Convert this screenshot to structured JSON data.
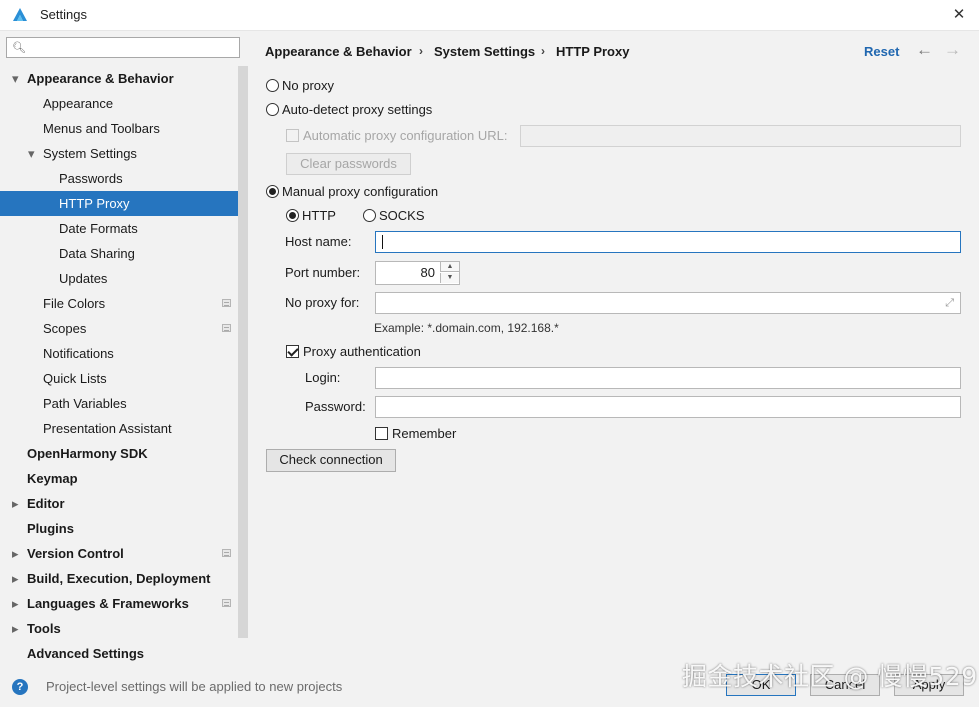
{
  "window": {
    "title": "Settings",
    "app_logo_icon": "harmony-logo-icon",
    "close_icon": "close-icon"
  },
  "search": {
    "icon": "search-icon",
    "value": "",
    "placeholder": ""
  },
  "sidebar": {
    "items": [
      {
        "label": "Appearance & Behavior",
        "level": 0,
        "expanded": true,
        "bold": true
      },
      {
        "label": "Appearance",
        "level": 1
      },
      {
        "label": "Menus and Toolbars",
        "level": 1
      },
      {
        "label": "System Settings",
        "level": 1,
        "expanded": true
      },
      {
        "label": "Passwords",
        "level": 2
      },
      {
        "label": "HTTP Proxy",
        "level": 2,
        "selected": true
      },
      {
        "label": "Date Formats",
        "level": 2
      },
      {
        "label": "Data Sharing",
        "level": 2
      },
      {
        "label": "Updates",
        "level": 2
      },
      {
        "label": "File Colors",
        "level": 1,
        "project_marker": true
      },
      {
        "label": "Scopes",
        "level": 1,
        "project_marker": true
      },
      {
        "label": "Notifications",
        "level": 1
      },
      {
        "label": "Quick Lists",
        "level": 1
      },
      {
        "label": "Path Variables",
        "level": 1
      },
      {
        "label": "Presentation Assistant",
        "level": 1
      },
      {
        "label": "OpenHarmony SDK",
        "level": 0,
        "bold": true
      },
      {
        "label": "Keymap",
        "level": 0,
        "bold": true
      },
      {
        "label": "Editor",
        "level": 0,
        "collapsed": true,
        "bold": true
      },
      {
        "label": "Plugins",
        "level": 0,
        "bold": true
      },
      {
        "label": "Version Control",
        "level": 0,
        "collapsed": true,
        "bold": true,
        "project_marker": true
      },
      {
        "label": "Build, Execution, Deployment",
        "level": 0,
        "collapsed": true,
        "bold": true
      },
      {
        "label": "Languages & Frameworks",
        "level": 0,
        "collapsed": true,
        "bold": true,
        "project_marker": true
      },
      {
        "label": "Tools",
        "level": 0,
        "collapsed": true,
        "bold": true
      },
      {
        "label": "Advanced Settings",
        "level": 0,
        "bold": true
      }
    ]
  },
  "breadcrumb": {
    "items": [
      "Appearance & Behavior",
      "System Settings",
      "HTTP Proxy"
    ],
    "separator": "›",
    "reset_label": "Reset",
    "back_icon": "arrow-left-icon",
    "forward_icon": "arrow-right-icon"
  },
  "proxy": {
    "no_proxy_label": "No proxy",
    "auto_detect_label": "Auto-detect proxy settings",
    "auto_config_url_label": "Automatic proxy configuration URL:",
    "auto_config_url_value": "",
    "clear_passwords_label": "Clear passwords",
    "manual_label": "Manual proxy configuration",
    "mode": "manual",
    "http_label": "HTTP",
    "socks_label": "SOCKS",
    "protocol": "HTTP",
    "host_label": "Host name:",
    "host_value": "",
    "port_label": "Port number:",
    "port_value": "80",
    "no_proxy_for_label": "No proxy for:",
    "no_proxy_for_value": "",
    "example_text": "Example: *.domain.com, 192.168.*",
    "auth_label": "Proxy authentication",
    "auth_checked": true,
    "login_label": "Login:",
    "login_value": "",
    "password_label": "Password:",
    "password_value": "",
    "remember_label": "Remember",
    "remember_checked": false,
    "check_connection_label": "Check connection"
  },
  "footer": {
    "info_icon": "help-icon",
    "status_text": "Project-level settings will be applied to new projects",
    "ok_label": "OK",
    "cancel_label": "Cancel",
    "apply_label": "Apply"
  },
  "watermark": {
    "text": "掘金技术社区 @ 慢慢529"
  },
  "colors": {
    "accent": "#2675bf",
    "link": "#2067b0",
    "selected_bg": "#2675bf"
  }
}
